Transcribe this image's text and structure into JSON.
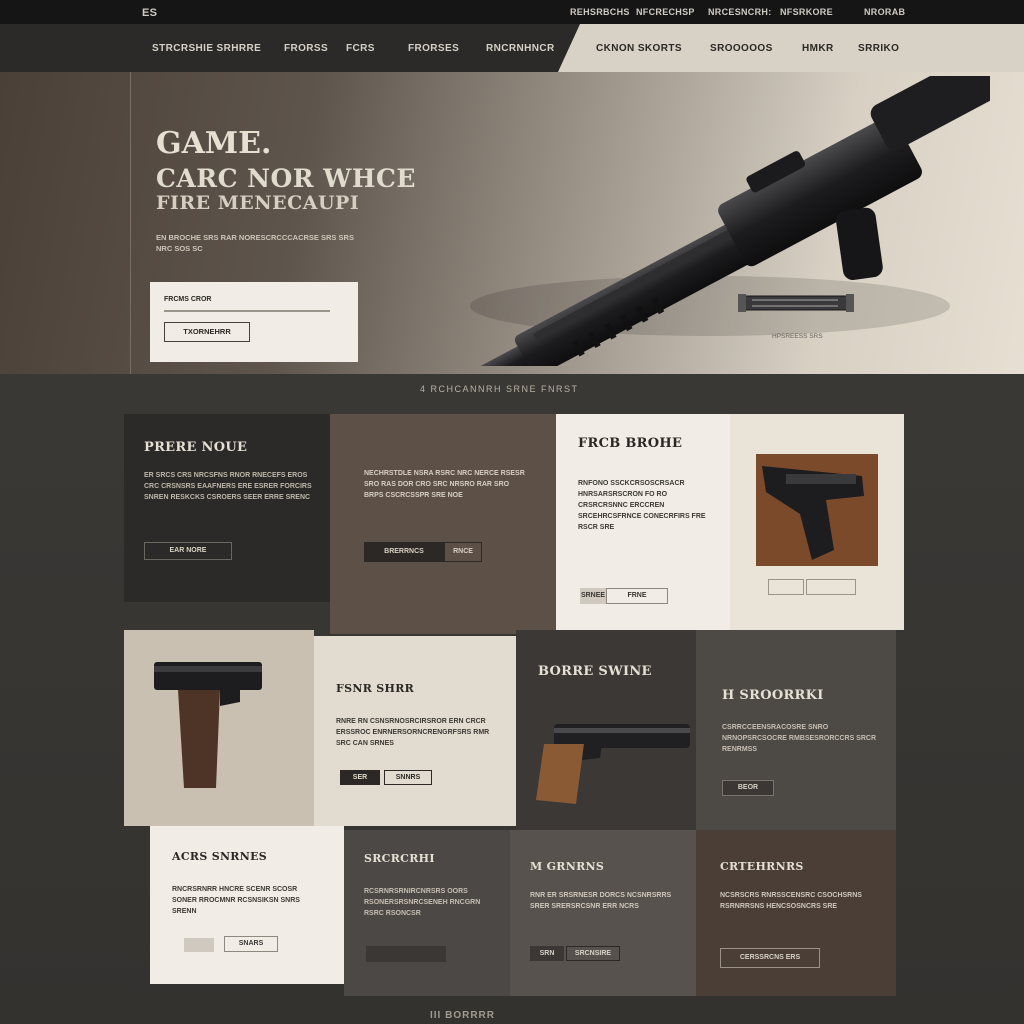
{
  "topbar": {
    "brand": "ES",
    "links": [
      "REHSRBCHS",
      "NFCRECHSP",
      "NRCESNCRH:",
      "NFSRKORE"
    ],
    "right": "NRORAB"
  },
  "nav": {
    "left_items": [
      "STRCRSHIE SRHRRE",
      "FRORSS",
      "FCRS",
      "FRORSES",
      "RNCRNHNCR"
    ],
    "right_items": [
      "CKNON SKORTS",
      "SROOOOOS",
      "HMKR",
      "SRRIKO"
    ]
  },
  "hero": {
    "title_small": "GAME.",
    "title_line1": "CARC NOR WHCE",
    "title_line2": "FIRE MENECAUPI",
    "subtitle": "EN BROCHE SRS RAR NORESCRCCCACRSE SRS SRS NRC SOS SC",
    "form_label": "FRCMS CROR",
    "form_button": "TXORNEHRR",
    "spec_caption": "HPSREESS SRS"
  },
  "strip": {
    "text": "4 RCHCANNRH SRNE FNRST"
  },
  "cards_row1": [
    {
      "title": "PRERE NOUE",
      "body": "ER SRCS CRS NRCSFNS RNOR RNECEFS EROS CRC CRSNSRS EAAFNERS ERE ESRER FORCIRS SNREN RESKCKS CSROERS SEER ERRE SRENC",
      "button": "EAR NORE"
    },
    {
      "title": "",
      "body": "NECHRSTDLE NSRA RSRC NRC NERCE RSESR SRO RAS DOR CRO SRC NRSRO RAR SRO BRPS CSCRCSSPR SRE NOE",
      "button": "BRERRNCS",
      "button2": "RNCE"
    },
    {
      "title": "FRCB BROHE",
      "body": "RNFONO SSCKCRSOSCRSACR HNRSARSRSCRON FO RO CRSRCRSNNC ERCCREN SRCEHRCSFRNCE CONECRFIRS FRE RSCR SRE",
      "button": "SRNEE",
      "button2": "FRNE"
    }
  ],
  "cards_row2": [
    {
      "title": "FSNR SHRR",
      "body": "RNRE RN CSNSRNOSRCIRSROR ERN CRCR ERSSROC ENRNERSORNCRENGRFSRS RMR SRC CAN SRNES",
      "button": "SER",
      "button2": "SNNRS"
    },
    {
      "title": "BORRE SWINE"
    },
    {
      "title": "H SROORRKI",
      "body": "CSRRCCEENSRACOSRE SNRO NRNOPSRCSOCRE RMBSESRORCCRS SRCR RENRMSS",
      "button": "BEOR"
    }
  ],
  "cards_row3": [
    {
      "title": "ACRS SNRNES",
      "body": "RNCRSRNRR HNCRE SCENR SCOSR SONER RROCMNR RCSNSIKSN SNRS SRENN",
      "button": "SNARS"
    },
    {
      "title": "SRCRCRHI",
      "body": "RCSRNRSRNIRCNRSRS OORS RSONERSRSNRCSENEH RNCGRN RSRC RSONCSR"
    },
    {
      "title": "M GRNRNS",
      "body": "RNR ER SRSRNESR DORCS NCSNRSRRS SRER SRERSRCSNR ERR NCRS",
      "button": "SRN",
      "button2": "SRCNSIRE"
    },
    {
      "title": "CRTEHRNRS",
      "body": "NCSRSCRS RNRSSCENSRC CSOCHSRNS RSRNRRSNS HENCSOSNCRS SRE",
      "button": "CERSSRCNS ERS"
    }
  ],
  "footer": {
    "text": "III BORRRR"
  },
  "colors": {
    "dark_panel": "#2c2a28",
    "cream": "#ece7dc",
    "taupe": "#5d5147",
    "accent_brown": "#8a5a34"
  }
}
